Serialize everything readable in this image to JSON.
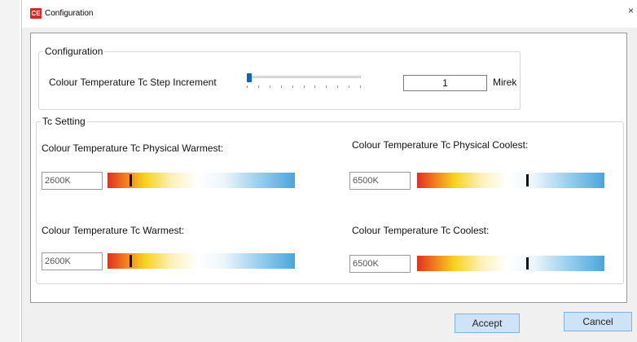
{
  "window": {
    "title": "Configuration",
    "icon": "app-logo-icon",
    "close_glyph": "×"
  },
  "config_group": {
    "legend": "Configuration",
    "step_label": "Colour Temperature Tc Step Increment",
    "step_value": "1",
    "step_unit": "Mirek",
    "slider_level": 0.0
  },
  "tc_group": {
    "legend": "Tc Setting",
    "physical_warmest": {
      "label": "Colour Temperature Tc Physical Warmest:",
      "value": "2600K",
      "marker_level": 0.12
    },
    "physical_coolest": {
      "label": "Colour Temperature Tc Physical Coolest:",
      "value": "6500K",
      "marker_level": 0.59
    },
    "warmest": {
      "label": "Colour Temperature Tc Warmest:",
      "value": "2600K",
      "marker_level": 0.12
    },
    "coolest": {
      "label": "Colour Temperature Tc Coolest:",
      "value": "6500K",
      "marker_level": 0.59
    }
  },
  "buttons": {
    "accept": "Accept",
    "cancel": "Cancel"
  },
  "colors": {
    "accent": "#0b63c6",
    "button_bg": "#cfe3f6"
  }
}
